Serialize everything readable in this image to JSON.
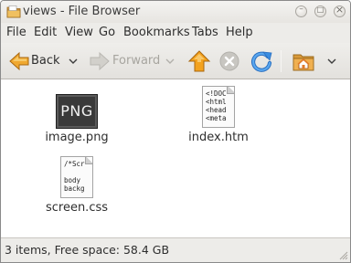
{
  "window": {
    "title": "views - File Browser",
    "folder_icon": "folder-icon",
    "controls": [
      {
        "icon": "minimize-icon",
        "glyph": "–"
      },
      {
        "icon": "maximize-icon",
        "glyph": "□"
      },
      {
        "icon": "close-icon",
        "glyph": "×"
      }
    ]
  },
  "menubar": {
    "items": [
      "File",
      "Edit",
      "View",
      "Go",
      "Bookmarks",
      "Tabs",
      "Help"
    ]
  },
  "toolbar": {
    "back_label": "Back",
    "forward_label": "Forward",
    "icons": [
      "back-arrow-icon",
      "forward-arrow-icon",
      "up-arrow-icon",
      "stop-icon",
      "reload-icon",
      "home-icon"
    ],
    "colors": {
      "back": "#f0a830",
      "up": "#f3a21e",
      "reload": "#3a8de0",
      "home": "#e07a2a",
      "disabled": "#b9b7b2"
    }
  },
  "files": [
    {
      "name": "image.png",
      "thumb_text": "PNG",
      "kind": "image"
    },
    {
      "name": "index.htm",
      "kind": "text",
      "preview": [
        "<!DOC",
        "<html",
        "<head",
        "<meta"
      ]
    },
    {
      "name": "screen.css",
      "kind": "text",
      "preview": [
        "/*Scr",
        "",
        "body",
        "backg"
      ]
    }
  ],
  "status": {
    "text": "3 items, Free space: 58.4 GB"
  }
}
